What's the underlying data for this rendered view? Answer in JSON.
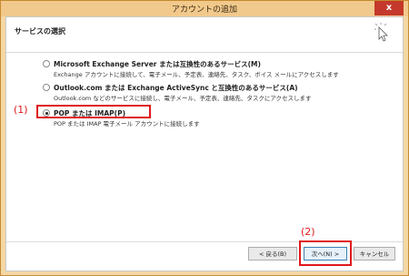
{
  "window": {
    "title": "アカウントの追加",
    "close_label": "x"
  },
  "header": {
    "title": "サービスの選択"
  },
  "options": [
    {
      "label": "Microsoft Exchange Server または互換性のあるサービス(M)",
      "description": "Exchange アカウントに接続して、電子メール、予定表、連絡先、タスク、ボイス メールにアクセスします",
      "checked": false
    },
    {
      "label": "Outlook.com または Exchange ActiveSync と互換性のあるサービス(A)",
      "description": "Outlook.com などのサービスに接続し、電子メール、予定表、連絡先、タスクにアクセスします",
      "checked": false
    },
    {
      "label": "POP または IMAP(P)",
      "description": "POP または IMAP 電子メール アカウントに接続します",
      "checked": true
    }
  ],
  "annotations": {
    "step1": "(1)",
    "step2": "(2)"
  },
  "footer": {
    "back_label": "< 戻る(B)",
    "next_label": "次へ(N) >",
    "cancel_label": "キャンセル"
  },
  "colors": {
    "accent_red": "#e0181b",
    "title_bar": "#f2c98c",
    "close_button": "#c4392b"
  }
}
